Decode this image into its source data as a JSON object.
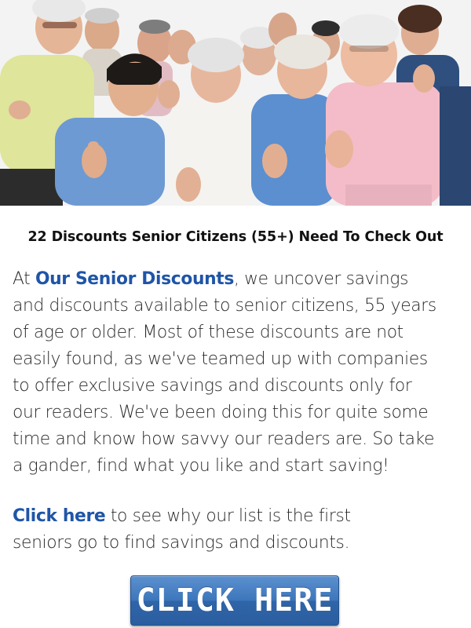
{
  "hero": {
    "icon": "group-of-seniors-thumbs-up-photo"
  },
  "headline": "22 Discounts Senior Citizens (55+) Need To Check Out",
  "intro": {
    "prefix": "At ",
    "brand_link": "Our Senior Discounts",
    "lines_first_rest": ", we uncover savings",
    "lines": [
      "and discounts available to senior citizens, 55 years",
      "of age or older. Most of these discounts are not",
      "easily found, as we've teamed up with companies",
      "to offer exclusive savings and discounts only for",
      "our readers. We've been doing this for quite some",
      "time and know how savvy our readers are. So take",
      "a gander, find what you like and start saving!"
    ]
  },
  "callout": {
    "link": "Click here",
    "first_rest": " to see why our list is the first",
    "second_line": "seniors go to find savings and discounts."
  },
  "cta": {
    "label": "CLICK HERE"
  },
  "colors": {
    "link_blue": "#1f55a8",
    "button_blue": "#3c74ba",
    "text": "#2a2a2a"
  }
}
